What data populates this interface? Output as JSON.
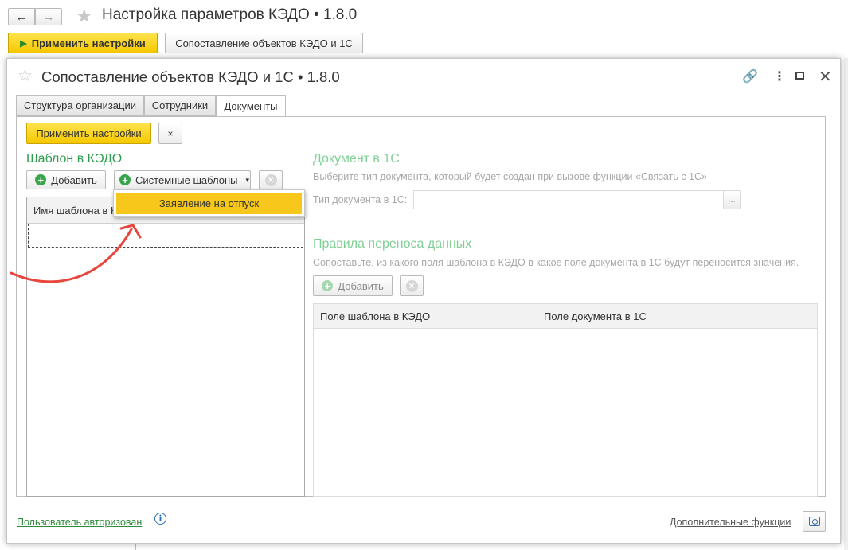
{
  "window": {
    "title": "Настройка параметров КЭДО • 1.8.0",
    "nav_back": "←",
    "nav_forward": "→",
    "star": "★",
    "apply_label": "Применить настройки",
    "mapping_label": "Сопоставление объектов КЭДО и 1С"
  },
  "modal": {
    "title": "Сопоставление объектов КЭДО и 1С • 1.8.0",
    "star": "☆",
    "controls": {
      "link": "🔗",
      "more": "⋮",
      "close": "✕"
    },
    "tabs": [
      {
        "label": "Структура организации",
        "active": false
      },
      {
        "label": "Сотрудники",
        "active": false
      },
      {
        "label": "Документы",
        "active": true
      }
    ],
    "toolbar": {
      "apply_label": "Применить настройки",
      "close_label": "×"
    },
    "template": {
      "title": "Шаблон в КЭДО",
      "add_label": "Добавить",
      "system_label": "Системные шаблоны",
      "caret": "▾",
      "table_header": "Имя шаблона в К",
      "dropdown_item": "Заявление на отпуск"
    },
    "document": {
      "title": "Документ в 1С",
      "hint": "Выберите тип документа, который будет создан при вызове функции «Связать с 1С»",
      "type_label": "Тип документа в 1С:",
      "type_value": "",
      "picker_label": "..."
    },
    "rules": {
      "title": "Правила переноса данных",
      "hint": "Сопоставьте, из какого поля шаблона в КЭДО в какое поле документа в 1С будут переносится значения.",
      "add_label": "Добавить",
      "columns": [
        "Поле шаблона в КЭДО",
        "Поле документа в 1С"
      ]
    },
    "footer": {
      "auth_label": "Пользователь авторизован",
      "info": "i",
      "more_label": "Дополнительные функции"
    }
  },
  "colors": {
    "accent_yellow": "#f5c800",
    "section_green": "#2e9c4f",
    "annotation_arrow": "#e8453c"
  },
  "icons": {
    "annotation": "curved-arrow-icon"
  }
}
